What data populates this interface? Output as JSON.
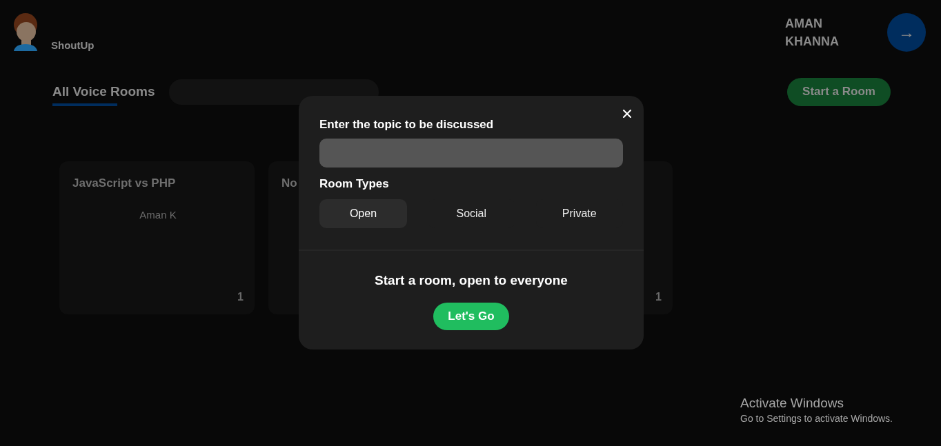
{
  "app": {
    "name": "ShoutUp"
  },
  "user": {
    "name": "AMAN KHANNA",
    "button": "→"
  },
  "rooms_tab": {
    "label": "All Voice Rooms",
    "selected": true
  },
  "start_button": "Start a Room",
  "rooms": [
    {
      "title": "JavaScript vs PHP",
      "speaker": "Aman K",
      "count": "1"
    },
    {
      "title": "No"
    },
    {
      "count": "1"
    }
  ],
  "modal": {
    "topic_label": "Enter the topic to be discussed",
    "types_label": "Room Types",
    "room_types": [
      {
        "label": "Open",
        "selected": true
      },
      {
        "label": "Social",
        "selected": false
      },
      {
        "label": "Private",
        "selected": false
      }
    ],
    "description": "Start a room, open to everyone",
    "submit": "Let's Go"
  },
  "os_notice": {
    "title": "Activate Windows",
    "text": "Go to Settings to activate Windows."
  }
}
